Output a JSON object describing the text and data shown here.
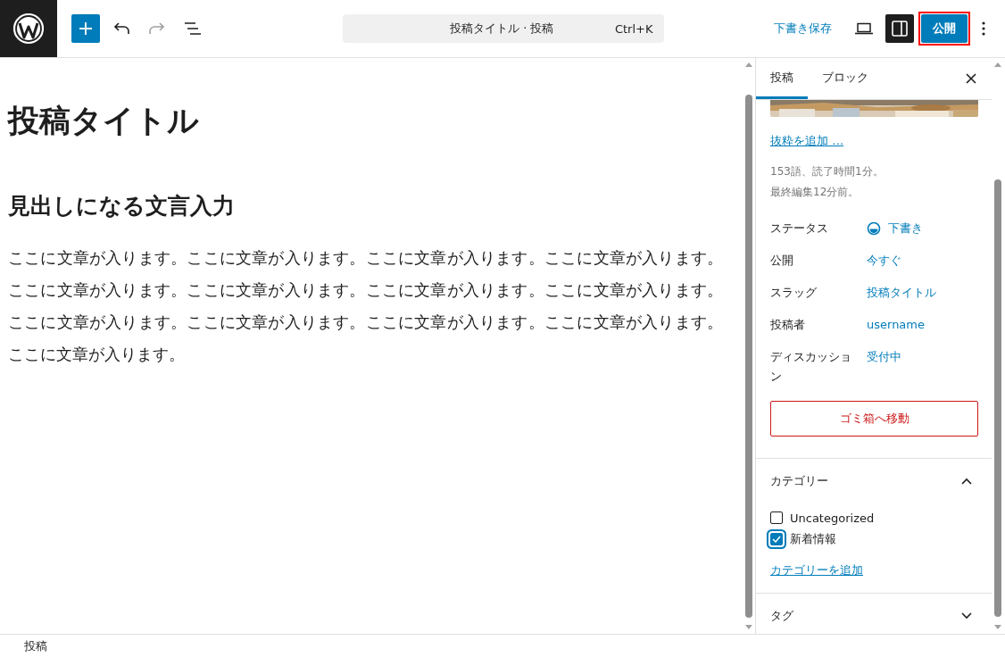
{
  "toolbar": {
    "tools": [
      {
        "kind": "add",
        "disabled": false
      },
      {
        "kind": "undo",
        "disabled": false
      },
      {
        "kind": "redo",
        "disabled": true
      },
      {
        "kind": "list",
        "disabled": false
      }
    ]
  },
  "command_bar": {
    "title": "投稿タイトル · 投稿",
    "shortcut": "Ctrl+K"
  },
  "actions": {
    "save_draft": "下書き保存",
    "sidebar_toggle_on": true,
    "publish": "公開",
    "publish_highlighted": true
  },
  "editor": {
    "title": "投稿タイトル",
    "blocks": [
      {
        "kind": "heading",
        "text": "見出しになる文言入力"
      },
      {
        "kind": "paragraph",
        "text": "ここに文章が入ります。ここに文章が入ります。ここに文章が入ります。ここに文章が入ります。ここに文章が入ります。ここに文章が入ります。ここに文章が入ります。ここに文章が入ります。ここに文章が入ります。ここに文章が入ります。ここに文章が入ります。ここに文章が入ります。ここに文章が入ります。"
      }
    ]
  },
  "sidebar": {
    "tabs": [
      {
        "label": "投稿",
        "selected": true
      },
      {
        "label": "ブロック",
        "selected": false
      }
    ],
    "excerpt_link": "抜粋を追加 …",
    "stats": [
      "153語、読了時間1分。",
      "最終編集12分前。"
    ],
    "fields": [
      {
        "label": "ステータス",
        "value": "下書き",
        "kind": "status"
      },
      {
        "label": "公開",
        "value": "今すぐ",
        "kind": "link"
      },
      {
        "label": "スラッグ",
        "value": "投稿タイトル",
        "kind": "link"
      },
      {
        "label": "投稿者",
        "value": "username",
        "kind": "link"
      },
      {
        "label": "ディスカッション",
        "value": "受付中",
        "kind": "link"
      }
    ],
    "trash_button": "ゴミ箱へ移動",
    "panels": [
      {
        "title": "カテゴリー",
        "expanded": true,
        "categories": [
          {
            "label": "Uncategorized",
            "checked": false
          },
          {
            "label": "新着情報",
            "checked": true
          }
        ],
        "add_link": "カテゴリーを追加"
      },
      {
        "title": "タグ",
        "expanded": false
      }
    ]
  },
  "status_bar": {
    "breadcrumb": "投稿"
  }
}
